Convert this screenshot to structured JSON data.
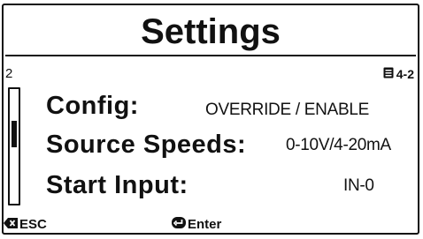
{
  "screen": {
    "title": "Settings",
    "scroll_position_label": "2",
    "page_indicator": "4-2"
  },
  "rows": [
    {
      "label": "Config:",
      "value": "OVERRIDE / ENABLE"
    },
    {
      "label": "Source Speeds:",
      "value": "0-10V/4-20mA"
    },
    {
      "label": "Start Input:",
      "value": "IN-0"
    }
  ],
  "footer": {
    "esc_label": "ESC",
    "enter_label": "Enter"
  },
  "icons": {
    "page": "page-list-icon",
    "esc": "backspace-x-icon",
    "enter": "enter-arrow-icon"
  }
}
